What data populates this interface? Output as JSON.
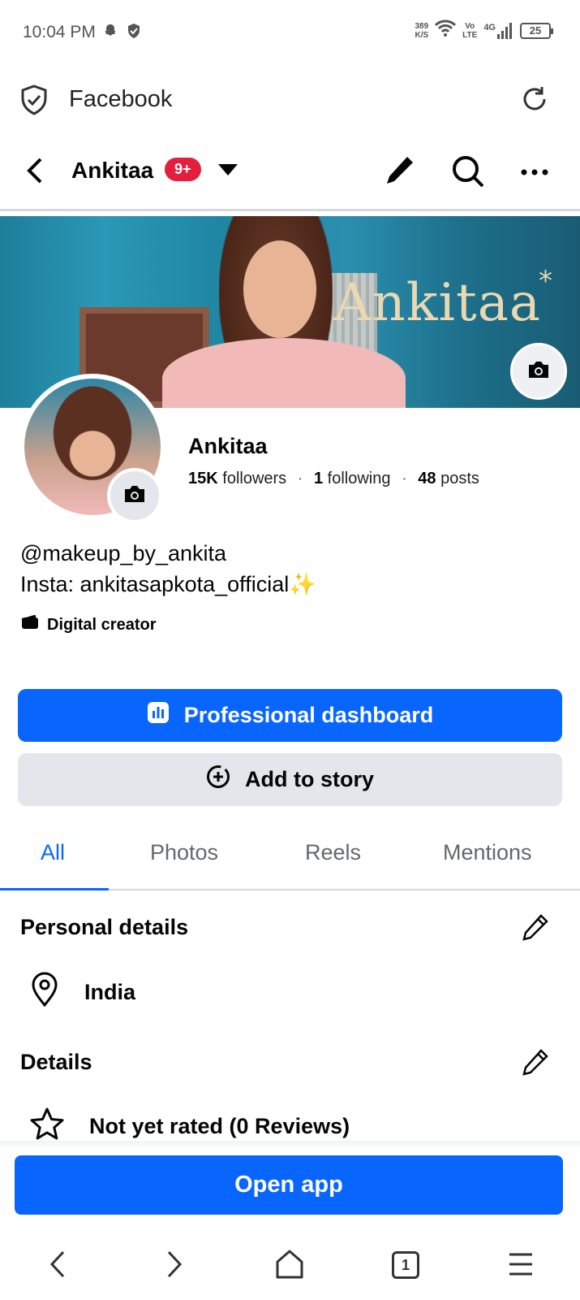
{
  "status_bar": {
    "time": "10:04 PM",
    "net_speed_value": "389",
    "net_speed_unit": "K/S",
    "volte_top": "Vo",
    "volte_bottom": "LTE",
    "network": "4G",
    "battery": "25"
  },
  "browser": {
    "title": "Facebook"
  },
  "header": {
    "name": "Ankitaa",
    "badge": "9+"
  },
  "cover": {
    "text": "Ankitaa",
    "star": "*"
  },
  "profile": {
    "name": "Ankitaa",
    "followers_count": "15K",
    "followers_label": "followers",
    "following_count": "1",
    "following_label": "following",
    "posts_count": "48",
    "posts_label": "posts",
    "separator": "·",
    "bio_line1": "@makeup_by_ankita",
    "bio_line2": "Insta: ankitasapkota_official✨",
    "category": "Digital creator"
  },
  "actions": {
    "dashboard_label": "Professional dashboard",
    "story_label": "Add to story"
  },
  "tabs": [
    {
      "label": "All",
      "active": true
    },
    {
      "label": "Photos",
      "active": false
    },
    {
      "label": "Reels",
      "active": false
    },
    {
      "label": "Mentions",
      "active": false
    }
  ],
  "personal_details": {
    "title": "Personal details",
    "location": "India"
  },
  "details": {
    "title": "Details",
    "rating": "Not yet rated (0 Reviews)"
  },
  "open_app": {
    "label": "Open app"
  },
  "nav": {
    "tab_count": "1"
  },
  "colors": {
    "accent": "#0866ff",
    "badge": "#e41e3f",
    "secondary_button": "#e4e6eb",
    "muted_text": "#65676b"
  }
}
